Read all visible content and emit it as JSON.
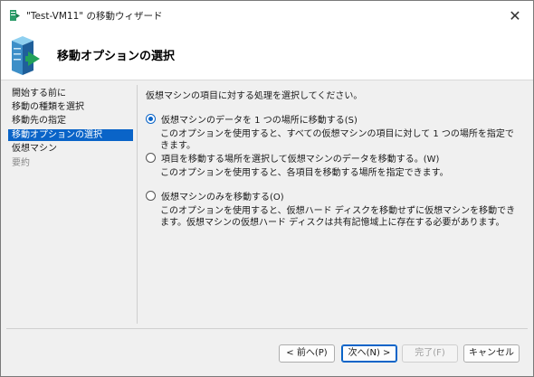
{
  "window": {
    "title": "\"Test-VM11\" の移動ウィザード",
    "close_glyph": "✕"
  },
  "header": {
    "title": "移動オプションの選択",
    "icon": "server-move-icon"
  },
  "sidebar": {
    "items": [
      {
        "label": "開始する前に",
        "state": "normal"
      },
      {
        "label": "移動の種類を選択",
        "state": "normal"
      },
      {
        "label": "移動先の指定",
        "state": "normal"
      },
      {
        "label": "移動オプションの選択",
        "state": "active"
      },
      {
        "label": "仮想マシン",
        "state": "normal"
      },
      {
        "label": "要約",
        "state": "dim"
      }
    ]
  },
  "main": {
    "prompt": "仮想マシンの項目に対する処理を選択してください。",
    "options": [
      {
        "label": "仮想マシンのデータを 1 つの場所に移動する(S)",
        "checked": true,
        "description": "このオプションを使用すると、すべての仮想マシンの項目に対して 1 つの場所を指定できます。"
      },
      {
        "label": "項目を移動する場所を選択して仮想マシンのデータを移動する。(W)",
        "checked": false,
        "description": "このオプションを使用すると、各項目を移動する場所を指定できます。"
      },
      {
        "label": "仮想マシンのみを移動する(O)",
        "checked": false,
        "description": "このオプションを使用すると、仮想ハード ディスクを移動せずに仮想マシンを移動できます。仮想マシンの仮想ハード ディスクは共有記憶域上に存在する必要があります。"
      }
    ]
  },
  "footer": {
    "prev_label": "< 前へ(P)",
    "next_label": "次へ(N) >",
    "finish_label": "完了(F)",
    "cancel_label": "キャンセル"
  },
  "colors": {
    "accent": "#0a64c8",
    "selected_text": "#ffffff",
    "dim_text": "#8a8a8a"
  }
}
